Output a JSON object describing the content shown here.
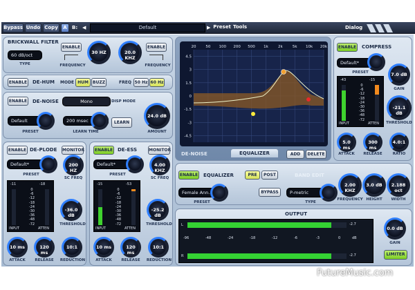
{
  "topbar": {
    "bypass": "Bypass",
    "undo": "Undo",
    "copy": "Copy",
    "ab": "A",
    "b": "B:",
    "preset_name": "Default",
    "preset": "Preset",
    "tools": "Tools",
    "dialog": "Dialog"
  },
  "brickwall": {
    "title": "BRICKWALL FILTER",
    "enable1": "ENABLE",
    "enable2": "ENABLE",
    "type_value": "60 dB/oct",
    "type_label": "TYPE",
    "freq1_label": "FREQUENCY",
    "freq2_label": "FREQUENCY",
    "knob1": "30 HZ",
    "knob2": "20.0 KHZ"
  },
  "dehum": {
    "enable": "ENABLE",
    "title": "DE-HUM",
    "mode": "MODE",
    "hum": "HUM",
    "buzz": "BUZZ",
    "freq": "FREQ",
    "f50": "50 Hz",
    "f60": "60 Hz"
  },
  "denoise": {
    "enable": "ENABLE",
    "title": "DE-NOISE",
    "mono": "Mono",
    "disp_mode": "DISP MODE",
    "preset_value": "Default",
    "preset_label": "PRESET",
    "learn_time_value": "200 msec",
    "learn_time_label": "LEARN TIME",
    "learn": "LEARN",
    "amount_knob": "24.0 dB",
    "amount_label": "AMOUNT"
  },
  "deplode": {
    "enable": "ENABLE",
    "title": "DE-PLODE",
    "monitor": "MONITOR",
    "preset_value": "Default*",
    "preset_label": "PRESET",
    "scfreq_knob": "200 HZ",
    "scfreq_label": "SC FREQ",
    "input_top": "-11",
    "atten_top": "-18",
    "scale": [
      "0",
      "-6",
      "-12",
      "-18",
      "-24",
      "-30",
      "-36",
      "-48",
      "-72"
    ],
    "input_label": "INPUT",
    "atten_label": "ATTEN",
    "threshold_knob": "-36.0 dB",
    "threshold_label": "THRESHOLD",
    "attack_knob": "10 ms",
    "attack_label": "ATTACK",
    "release_knob": "120 ms",
    "release_label": "RELEASE",
    "reduction_knob": "10:1",
    "reduction_label": "REDUCTION"
  },
  "deess": {
    "enable": "ENABLE",
    "title": "DE-ESS",
    "monitor": "MONITOR",
    "preset_value": "Default*",
    "preset_label": "PRESET",
    "scfreq_knob": "4.00 KHZ",
    "scfreq_label": "SC FREQ",
    "input_top": "-15",
    "atten_top": "-53",
    "scale": [
      "0",
      "-6",
      "-12",
      "-18",
      "-24",
      "-30",
      "-36",
      "-48",
      "-72"
    ],
    "input_label": "INPUT",
    "atten_label": "ATTEN",
    "threshold_knob": "-25.2 dB",
    "threshold_label": "THRESHOLD",
    "attack_knob": "10 ms",
    "attack_label": "ATTACK",
    "release_knob": "120 ms",
    "release_label": "RELEASE",
    "reduction_knob": "10:1",
    "reduction_label": "REDUCTION"
  },
  "eq": {
    "x_ticks": [
      "20",
      "50",
      "100",
      "200",
      "500",
      "1k",
      "2k",
      "5k",
      "10k",
      "20k"
    ],
    "y_ticks": [
      "4.5",
      "3",
      "1.5",
      "0",
      "-1.5",
      "-3",
      "-4.5"
    ],
    "tab_denoise": "DE-NOISE",
    "tab_equalizer": "EQUALIZER",
    "add": "ADD",
    "delete": "DELETE",
    "enable": "ENABLE",
    "title": "EQUALIZER",
    "pre": "PRE",
    "post": "POST",
    "preset_value": "Female Ann..",
    "preset_label": "PRESET",
    "bypass": "BYPASS",
    "band_edit": "BAND EDIT",
    "type_value": "P-metric",
    "type_label": "TYPE",
    "freq_knob": "2.00 KHZ",
    "freq_label": "FREQUENCY",
    "height_knob": "3.0 dB",
    "height_label": "HEIGHT",
    "width_knob": "2.188 oct",
    "width_label": "WIDTH"
  },
  "compress": {
    "enable": "ENABLE",
    "title": "COMPRESS",
    "preset_value": "Default*",
    "preset_label": "PRESET",
    "input_top": "-43",
    "atten_top": "-15",
    "scale": [
      "0",
      "-6",
      "-12",
      "-18",
      "-24",
      "-30",
      "-36",
      "-48",
      "-72"
    ],
    "input_label": "INPUT",
    "atten_label": "ATTEN",
    "gain_knob": "7.0 dB",
    "gain_label": "GAIN",
    "threshold_knob": "-21.1 dB",
    "threshold_label": "THRESHOLD",
    "attack_knob": "5.0 ms",
    "attack_label": "ATTACK",
    "release_knob": "300 ms",
    "release_label": "RELEASE",
    "ratio_knob": "4.0:1",
    "ratio_label": "RATIO"
  },
  "output": {
    "title": "OUTPUT",
    "left_label": "L",
    "right_label": "R",
    "left_peak": "-2.7",
    "right_peak": "-2.7",
    "db_label": "dB",
    "scale": [
      "-96",
      "-48",
      "-24",
      "-18",
      "-12",
      "-6",
      "-3",
      "0"
    ],
    "gain_knob": "0.0 dB",
    "gain_label": "GAIN",
    "limiter": "LIMITER"
  },
  "watermark": "FutureMusic.com"
}
